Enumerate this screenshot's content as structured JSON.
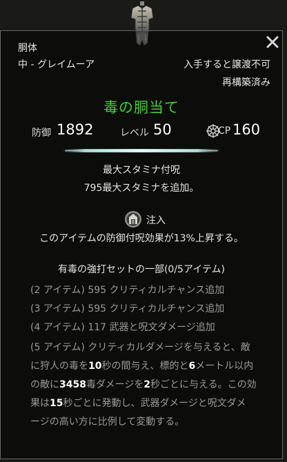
{
  "item": {
    "slot": "胴体",
    "armor_type": "中 - グレイムーア",
    "bind_status": "入手すると譲渡不可",
    "reconstruct_status": "再構築済み",
    "name": "毒の胴当て",
    "name_color": "#3fd12e"
  },
  "stats": {
    "armor_label": "防御",
    "armor_value": "1892",
    "level_label": "レベル",
    "level_value": "50",
    "cp_label": "CP",
    "cp_value": "160"
  },
  "enchant": {
    "title": "最大スタミナ付呪",
    "desc": "795最大スタミナを追加。"
  },
  "trait": {
    "name": "注入",
    "desc": "このアイテムの防御付呪効果が13%上昇する。"
  },
  "set": {
    "title": "有毒の強打セットの一部(0/5アイテム)",
    "bonuses": [
      "(2 アイテム) 595 クリティカルチャンス追加",
      "(3 アイテム) 595 クリティカルチャンス追加",
      "(4 アイテム) 117 武器と呪文ダメージ追加"
    ],
    "bonus5_lines": [
      [
        [
          "(5 アイテム) クリティカルダメージを与えると、敵",
          false
        ]
      ],
      [
        [
          "に狩人の毒を",
          false
        ],
        [
          "10",
          true
        ],
        [
          "秒の間与え、標的と",
          false
        ],
        [
          "6",
          true
        ],
        [
          "メートル以内",
          false
        ]
      ],
      [
        [
          "の敵に",
          false
        ],
        [
          "3458",
          true
        ],
        [
          "毒ダメージを",
          false
        ],
        [
          "2",
          true
        ],
        [
          "秒ごとに与える。この効",
          false
        ]
      ],
      [
        [
          "果は",
          false
        ],
        [
          "15",
          true
        ],
        [
          "秒ごとに発動し、武器ダメージと呪文ダメ",
          false
        ]
      ],
      [
        [
          "ージの高い方に比例して変動する。",
          false
        ]
      ]
    ]
  },
  "icons": {
    "item": "chest-armor-icon",
    "close": "close-icon",
    "cp": "champion-point-icon",
    "trait": "infused-trait-icon"
  }
}
